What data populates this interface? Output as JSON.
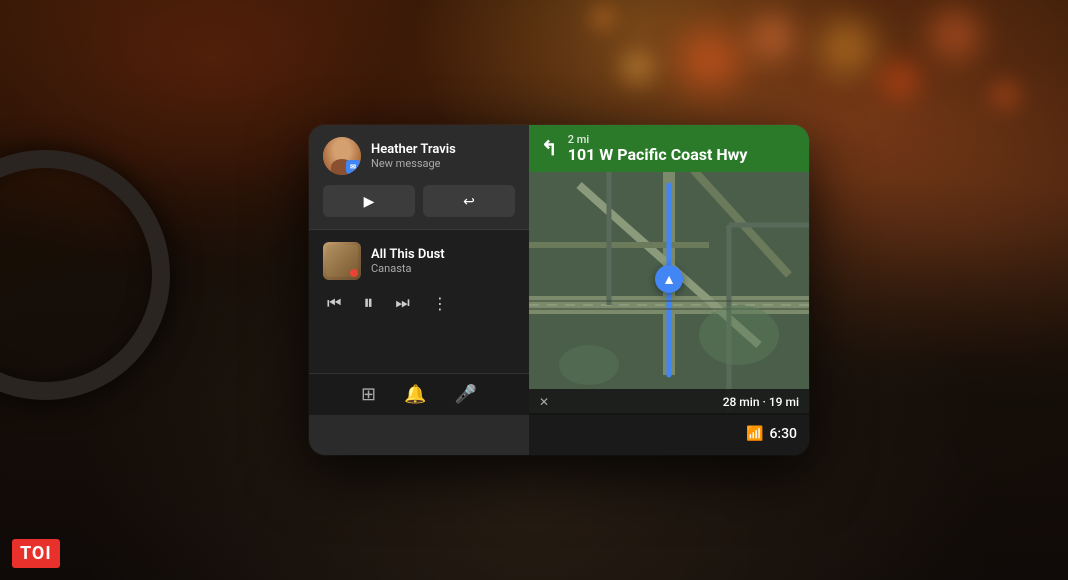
{
  "background": {
    "colors": {
      "primary": "#1a1008",
      "dashboard": "#2a2520"
    }
  },
  "toi": {
    "label": "TOI"
  },
  "screen": {
    "message_card": {
      "sender": "Heather Travis",
      "subtitle": "New message",
      "play_btn": "▶",
      "reply_btn": "↩"
    },
    "music_card": {
      "song_title": "All This Dust",
      "artist": "Canasta"
    },
    "music_controls": {
      "prev": "⏮",
      "pause": "⏸",
      "next": "⏭",
      "more": "⋮"
    },
    "nav_bar": {
      "grid_icon": "⊞",
      "bell_icon": "🔔",
      "mic_icon": "🎤"
    },
    "map": {
      "distance": "2 mi",
      "street": "101 W Pacific Coast Hwy",
      "eta": "28 min · 19 mi",
      "time": "6:30"
    }
  }
}
